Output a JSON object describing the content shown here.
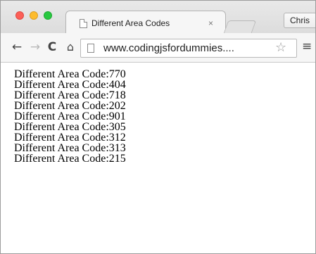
{
  "tab": {
    "title": "Different Area Codes",
    "close_glyph": "×"
  },
  "profile": {
    "name": "Chris"
  },
  "toolbar": {
    "url": "www.codingjsfordummies....",
    "back_glyph": "←",
    "forward_glyph": "→",
    "reload_glyph": "C",
    "home_glyph": "⌂",
    "star_glyph": "☆",
    "menu_glyph": "≡"
  },
  "icons": {
    "back": "back-arrow-icon",
    "forward": "forward-arrow-icon",
    "reload": "reload-icon",
    "home": "home-icon",
    "page": "page-icon",
    "star": "bookmark-star-icon",
    "menu": "hamburger-menu-icon"
  },
  "content": {
    "lines": [
      "Different Area Code:770",
      "Different Area Code:404",
      "Different Area Code:718",
      "Different Area Code:202",
      "Different Area Code:901",
      "Different Area Code:305",
      "Different Area Code:312",
      "Different Area Code:313",
      "Different Area Code:215"
    ]
  },
  "colors": {
    "traffic_close": "#fc5f57",
    "traffic_minimize": "#fdbc2e",
    "traffic_maximize": "#28c840"
  }
}
